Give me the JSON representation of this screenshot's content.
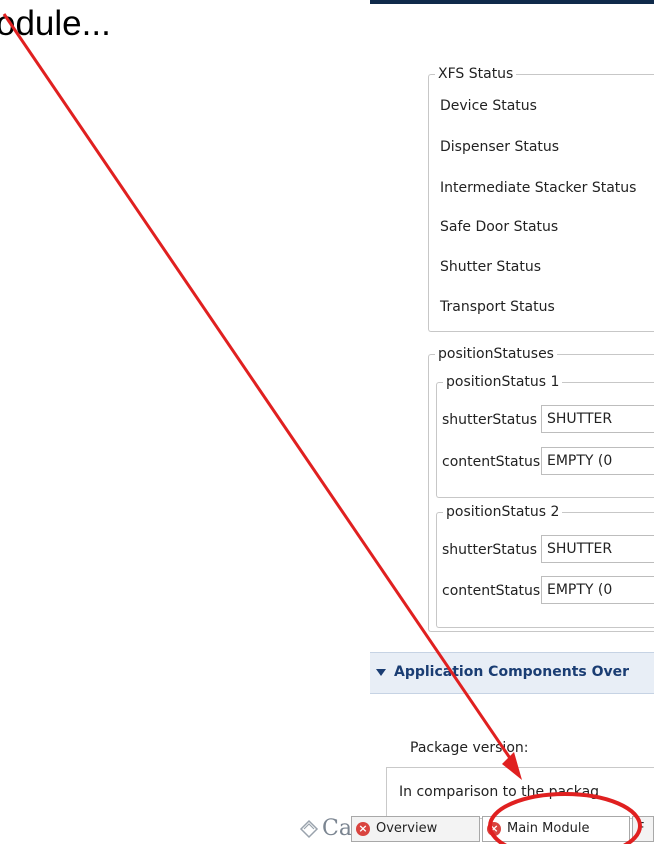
{
  "slide": {
    "title_fragment": "odule..."
  },
  "xfs_status": {
    "legend": "XFS Status",
    "rows": [
      "Device Status",
      "Dispenser Status",
      "Intermediate Stacker Status",
      "Safe Door Status",
      "Shutter Status",
      "Transport Status"
    ]
  },
  "position_statuses": {
    "legend": "positionStatuses",
    "groups": [
      {
        "legend": "positionStatus 1",
        "shutter_label": "shutterStatus",
        "shutter_value": "SHUTTER",
        "content_label": "contentStatus",
        "content_value": "EMPTY (0"
      },
      {
        "legend": "positionStatus 2",
        "shutter_label": "shutterStatus",
        "shutter_value": "SHUTTER",
        "content_label": "contentStatus",
        "content_value": "EMPTY (0"
      }
    ]
  },
  "app_components": {
    "title": "Application Components Over"
  },
  "package": {
    "label": "Package version:",
    "box_text": "In comparison to the packag"
  },
  "bottom_bar": {
    "logo_fragment": "Ca",
    "tabs": [
      "Overview",
      "Main Module",
      "F"
    ]
  },
  "colors": {
    "annotation_red": "#e02020",
    "section_blue": "#1a3d73",
    "error_icon": "#d9443f"
  },
  "icons": {
    "tab_error": "error-icon",
    "section_toggle": "collapse-triangle-icon",
    "logo": "logo-icon"
  }
}
